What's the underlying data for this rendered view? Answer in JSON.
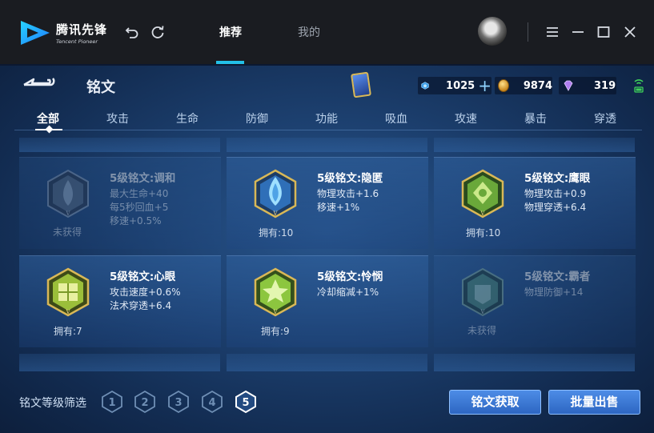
{
  "app": {
    "logo_cn": "腾讯先锋",
    "logo_en": "Tencent Pioneer"
  },
  "titlebar": {
    "tabs": [
      {
        "label": "推荐",
        "active": true
      },
      {
        "label": "我的",
        "active": false
      }
    ],
    "icons": [
      "undo-icon",
      "refresh-icon",
      "menu-icon",
      "minimize-icon",
      "maximize-icon",
      "close-icon"
    ]
  },
  "page": {
    "title": "铭文",
    "resources": {
      "coupon": "1025",
      "gold": "9874",
      "diamond": "319"
    }
  },
  "categories": [
    "全部",
    "攻击",
    "生命",
    "防御",
    "功能",
    "吸血",
    "攻速",
    "暴击",
    "穿透"
  ],
  "active_category": "全部",
  "cards": [
    {
      "name": "5级铭文:调和",
      "stats": [
        "最大生命+40",
        "每5秒回血+5",
        "移速+0.5%"
      ],
      "count": "未获得",
      "owned": false,
      "color": "#5a6e86"
    },
    {
      "name": "5级铭文:隐匿",
      "stats": [
        "物理攻击+1.6",
        "移速+1%"
      ],
      "count": "拥有:10",
      "owned": true,
      "color": "#4fa3e6"
    },
    {
      "name": "5级铭文:鹰眼",
      "stats": [
        "物理攻击+0.9",
        "物理穿透+6.4"
      ],
      "count": "拥有:10",
      "owned": true,
      "color": "#7ac24a"
    },
    {
      "name": "5级铭文:心眼",
      "stats": [
        "攻击速度+0.6%",
        "法术穿透+6.4"
      ],
      "count": "拥有:7",
      "owned": true,
      "color": "#9bbf3a"
    },
    {
      "name": "5级铭文:怜悯",
      "stats": [
        "冷却缩减+1%"
      ],
      "count": "拥有:9",
      "owned": true,
      "color": "#8cc63f"
    },
    {
      "name": "5级铭文:霸者",
      "stats": [
        "物理防御+14"
      ],
      "count": "未获得",
      "owned": false,
      "color": "#4e8a72"
    }
  ],
  "bottom": {
    "filter_label": "铭文等级筛选",
    "levels": [
      "1",
      "2",
      "3",
      "4",
      "5"
    ],
    "active_level": "5",
    "get_button": "铭文获取",
    "sell_button": "批量出售"
  }
}
